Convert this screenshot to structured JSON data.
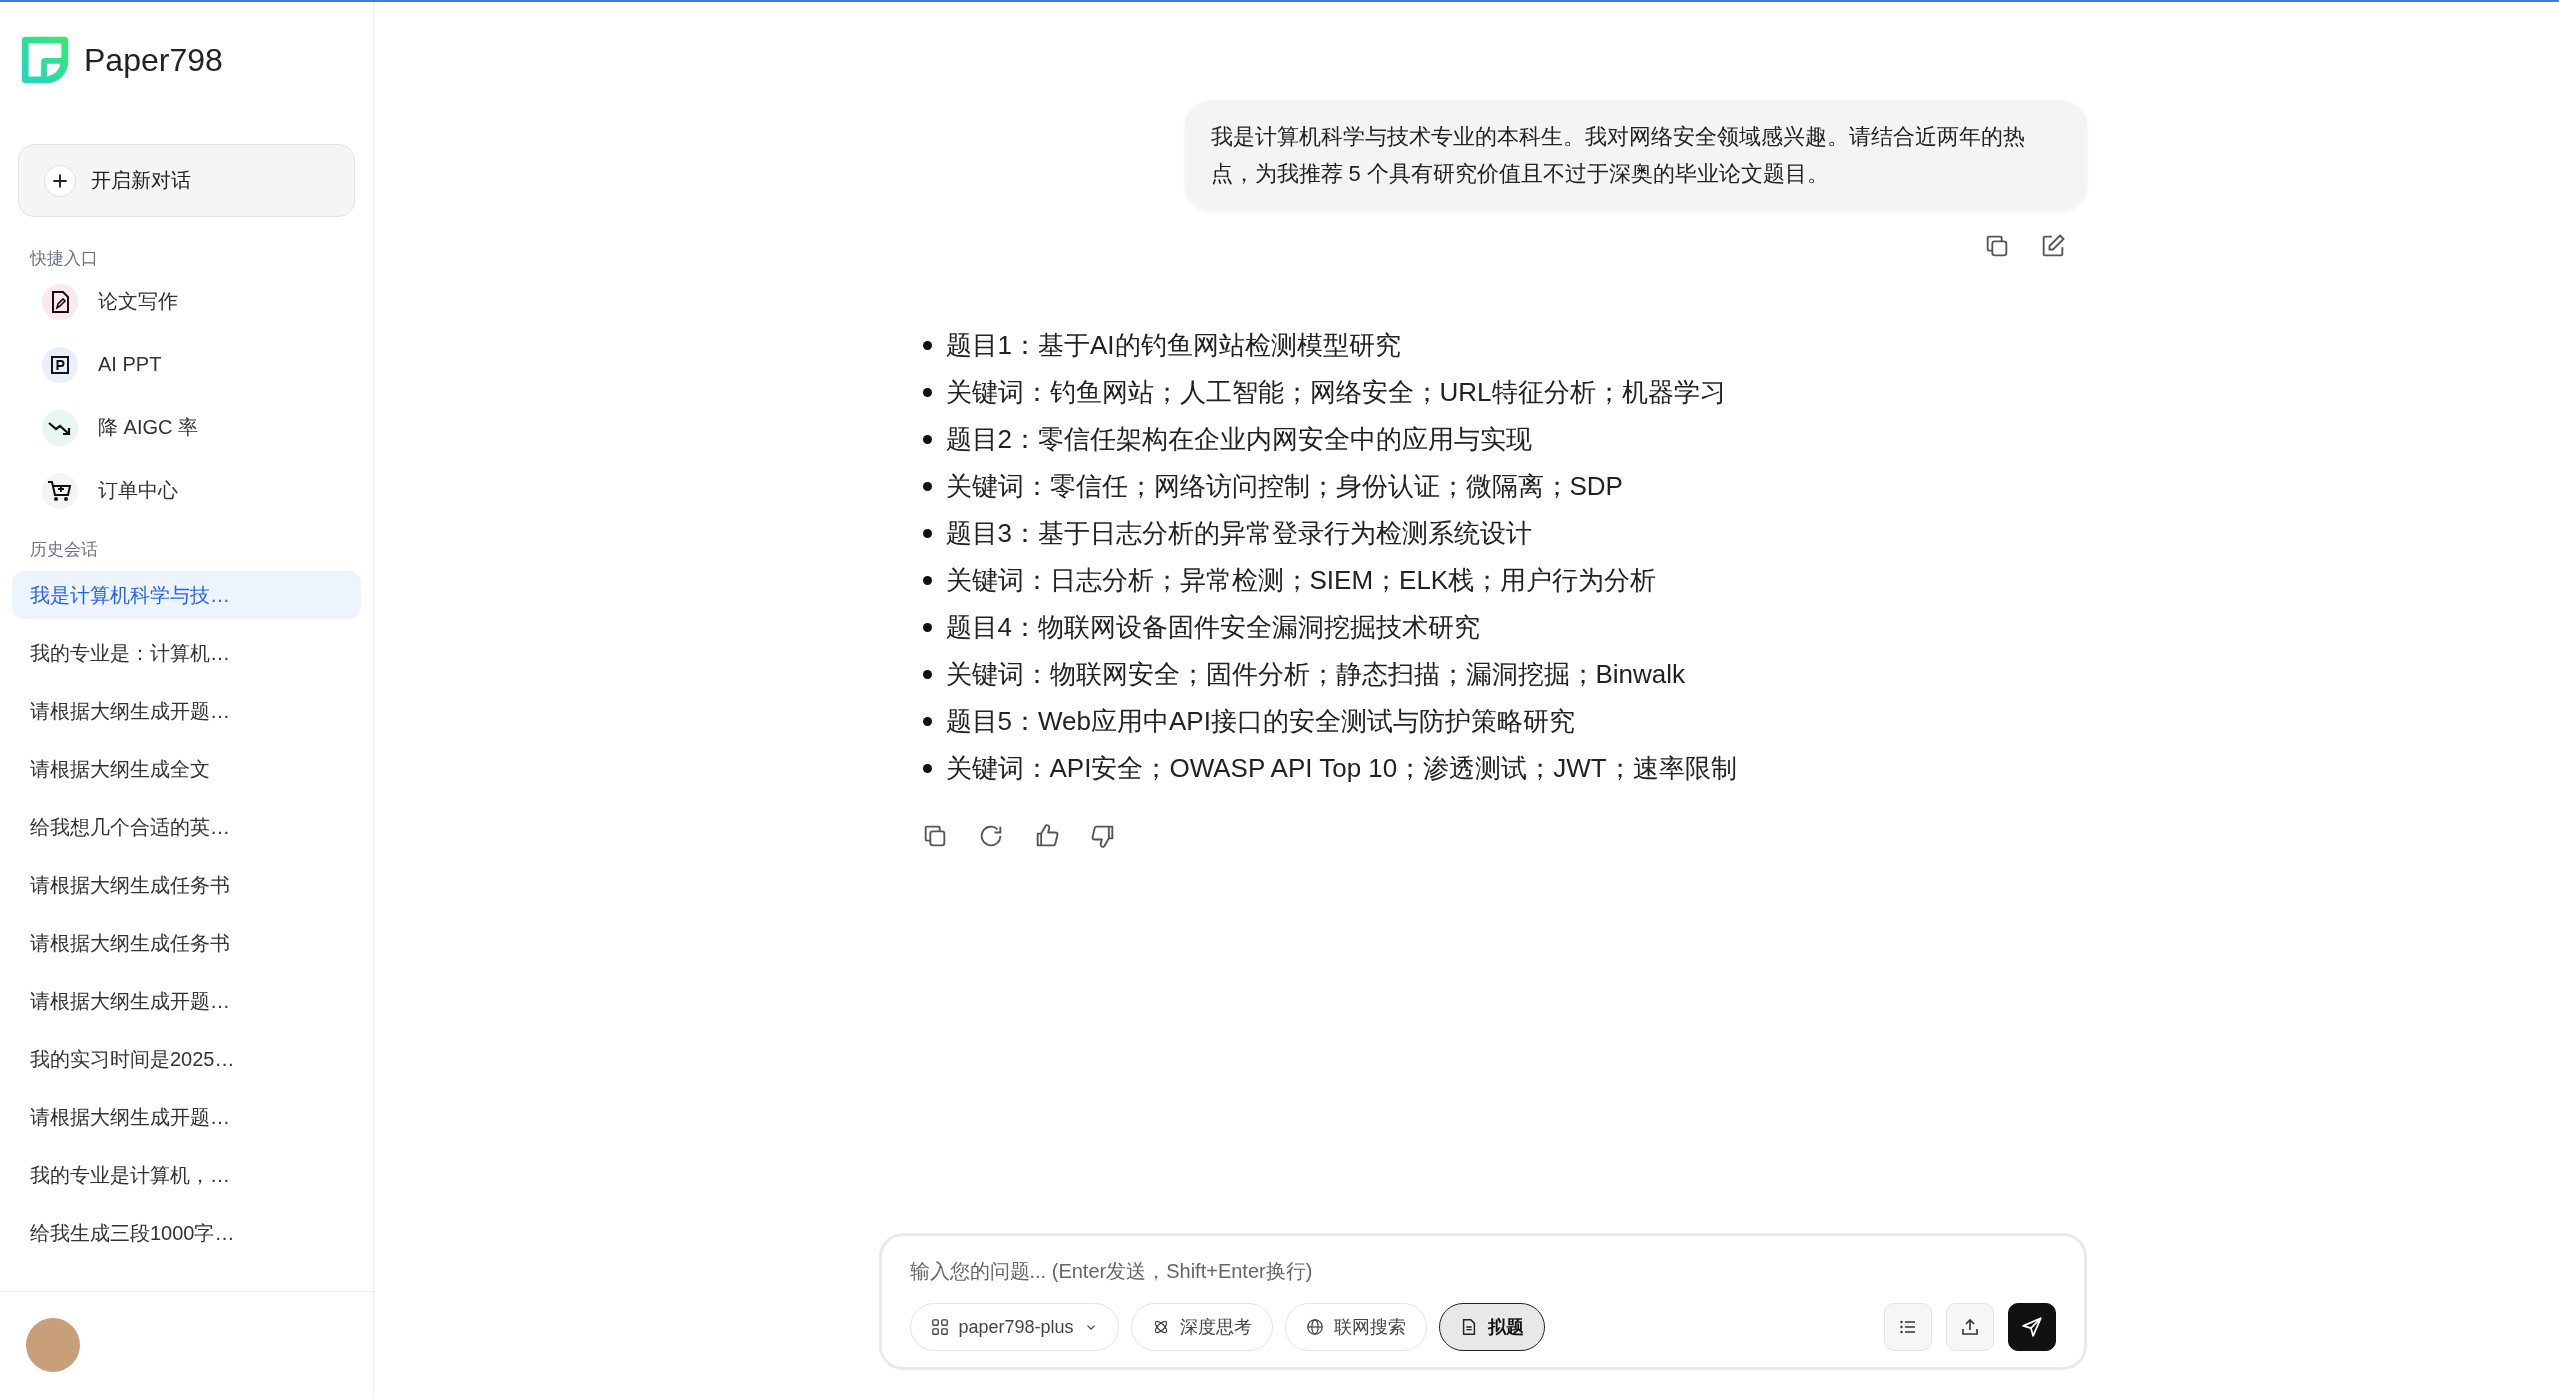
{
  "app": {
    "name": "Paper798"
  },
  "sidebar": {
    "new_chat": "开启新对话",
    "quick_title": "快捷入口",
    "quick_items": [
      {
        "kind": "write",
        "label": "论文写作"
      },
      {
        "kind": "ppt",
        "label": "AI PPT"
      },
      {
        "kind": "aigc",
        "label": "降 AIGC 率"
      },
      {
        "kind": "orders",
        "label": "订单中心"
      }
    ],
    "history_title": "历史会话",
    "history": [
      {
        "label": "我是计算机科学与技…",
        "selected": true
      },
      {
        "label": "我的专业是：计算机…",
        "selected": false
      },
      {
        "label": "请根据大纲生成开题…",
        "selected": false
      },
      {
        "label": "请根据大纲生成全文",
        "selected": false
      },
      {
        "label": "给我想几个合适的英…",
        "selected": false
      },
      {
        "label": "请根据大纲生成任务书",
        "selected": false
      },
      {
        "label": "请根据大纲生成任务书",
        "selected": false
      },
      {
        "label": "请根据大纲生成开题…",
        "selected": false
      },
      {
        "label": "我的实习时间是2025…",
        "selected": false
      },
      {
        "label": "请根据大纲生成开题…",
        "selected": false
      },
      {
        "label": "我的专业是计算机，…",
        "selected": false
      },
      {
        "label": "给我生成三段1000字…",
        "selected": false
      }
    ]
  },
  "chat": {
    "user_message": "我是计算机科学与技术专业的本科生。我对网络安全领域感兴趣。请结合近两年的热点，为我推荐 5 个具有研究价值且不过于深奥的毕业论文题目。",
    "answer": [
      "题目1：基于AI的钓鱼网站检测模型研究",
      "关键词：钓鱼网站；人工智能；网络安全；URL特征分析；机器学习",
      "题目2：零信任架构在企业内网安全中的应用与实现",
      "关键词：零信任；网络访问控制；身份认证；微隔离；SDP",
      "题目3：基于日志分析的异常登录行为检测系统设计",
      "关键词：日志分析；异常检测；SIEM；ELK栈；用户行为分析",
      "题目4：物联网设备固件安全漏洞挖掘技术研究",
      "关键词：物联网安全；固件分析；静态扫描；漏洞挖掘；Binwalk",
      "题目5：Web应用中API接口的安全测试与防护策略研究",
      "关键词：API安全；OWASP API Top 10；渗透测试；JWT；速率限制"
    ]
  },
  "composer": {
    "placeholder": "输入您的问题... (Enter发送，Shift+Enter换行)",
    "model": "paper798-plus",
    "toggles": [
      {
        "kind": "think",
        "label": "深度思考",
        "on": false
      },
      {
        "kind": "web",
        "label": "联网搜索",
        "on": false
      },
      {
        "kind": "topic",
        "label": "拟题",
        "on": true
      }
    ]
  }
}
